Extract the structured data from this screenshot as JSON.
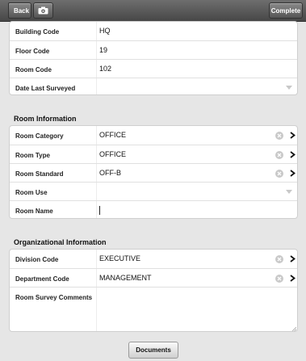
{
  "toolbar": {
    "back_label": "Back",
    "complete_label": "Complete",
    "camera_icon": "camera-icon"
  },
  "location_fields": [
    {
      "label": "Building Code",
      "value": "HQ"
    },
    {
      "label": "Floor Code",
      "value": "19"
    },
    {
      "label": "Room Code",
      "value": "102"
    },
    {
      "label": "Date Last Surveyed",
      "value": ""
    }
  ],
  "room_info": {
    "title": "Room Information",
    "fields": [
      {
        "label": "Room Category",
        "value": "OFFICE"
      },
      {
        "label": "Room Type",
        "value": "OFFICE"
      },
      {
        "label": "Room Standard",
        "value": "OFF-B"
      },
      {
        "label": "Room Use",
        "value": ""
      },
      {
        "label": "Room Name",
        "value": ""
      }
    ]
  },
  "org_info": {
    "title": "Organizational Information",
    "fields": [
      {
        "label": "Division Code",
        "value": "EXECUTIVE"
      },
      {
        "label": "Department Code",
        "value": "MANAGEMENT"
      },
      {
        "label": "Room Survey Comments",
        "value": ""
      }
    ]
  },
  "documents_label": "Documents",
  "colors": {
    "toolbar": "#474747",
    "background": "#e6e6e6",
    "panel": "#ffffff"
  }
}
